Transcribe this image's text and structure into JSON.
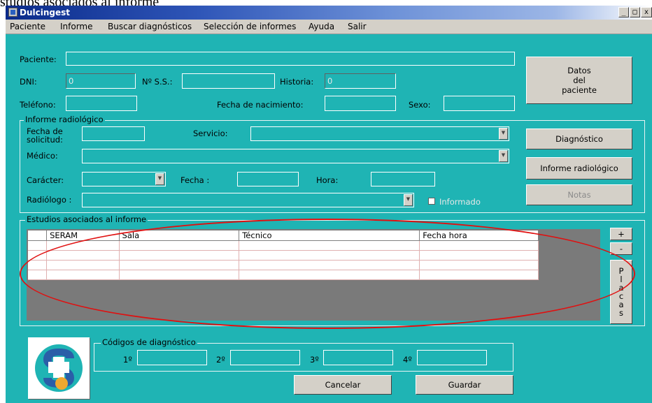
{
  "caption_partial": "studios asociados al informe",
  "window": {
    "title": "Dulcingest",
    "controls": [
      "_",
      "□",
      "x"
    ]
  },
  "menu": [
    {
      "label": "Paciente"
    },
    {
      "label": "Informe"
    },
    {
      "label": "Buscar diagnósticos"
    },
    {
      "label": "Selección de informes"
    },
    {
      "label": "Ayuda"
    },
    {
      "label": "Salir"
    }
  ],
  "patient": {
    "paciente_label": "Paciente:",
    "dni_label": "DNI:",
    "dni_value": "0",
    "nss_label": "Nº S.S.:",
    "historia_label": "Historia:",
    "historia_value": "0",
    "telefono_label": "Teléfono:",
    "fecha_nac_label": "Fecha de nacimiento:",
    "sexo_label": "Sexo:"
  },
  "informe": {
    "group_title": "Informe radiológico",
    "fecha_solicitud_label_1": "Fecha de",
    "fecha_solicitud_label_2": "solicitud:",
    "servicio_label": "Servicio:",
    "medico_label": "Médico:",
    "caracter_label": "Carácter:",
    "fecha_label": "Fecha :",
    "hora_label": "Hora:",
    "radiologo_label": "Radiólogo :",
    "informado_label": "Informado"
  },
  "buttons": {
    "datos_paciente_1": "Datos",
    "datos_paciente_2": "del",
    "datos_paciente_3": "paciente",
    "diagnostico": "Diagnóstico",
    "informe_radiologico": "Informe radiológico",
    "notas": "Notas",
    "plus": "+",
    "minus": "-",
    "placas": [
      "P",
      "l",
      "a",
      "c",
      "a",
      "s"
    ],
    "cancelar": "Cancelar",
    "guardar": "Guardar"
  },
  "estudios": {
    "group_title": "Estudios asociados al informe",
    "columns": [
      "",
      "SERAM",
      "Sala",
      "Técnico",
      "Fecha hora"
    ]
  },
  "codigos": {
    "group_title": "Códigos de diagnóstico",
    "labels": [
      "1º",
      "2º",
      "3º",
      "4º"
    ]
  },
  "colors": {
    "background": "#1fb4b4",
    "annotation": "#e01010",
    "grid_bg": "#7a7a7a"
  }
}
